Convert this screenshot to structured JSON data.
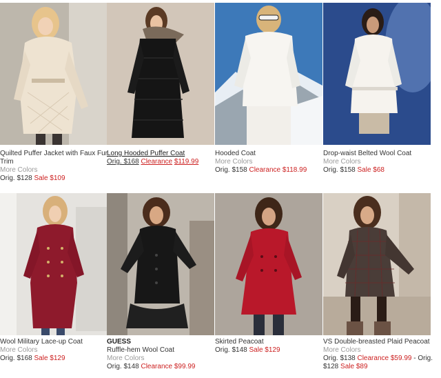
{
  "products": [
    {
      "name": "Quilted Puffer Jacket with Faux Fur Trim",
      "more_colors": "More Colors",
      "orig": "Orig.  $128",
      "sale_label": "Sale",
      "sale_price": "$109",
      "photo": "woman in cream quilted puffer jacket",
      "coat_color": "#efe4d2",
      "bg_color": "#c8c2b6"
    },
    {
      "name": "Long Hooded Puffer Coat",
      "orig": "Orig.  $168",
      "clearance_label": "Clearance",
      "clearance_price": "$119.99",
      "photo": "woman in long black hooded puffer coat",
      "coat_color": "#1a1a1a",
      "bg_color": "#cfc3b6"
    },
    {
      "name": "Hooded Coat",
      "more_colors": "More Colors",
      "orig": "Orig.  $158",
      "clearance_label": "Clearance",
      "clearance_price": "$118.99",
      "photo": "woman in white hooded coat on snowy mountain",
      "coat_color": "#f6f4f0",
      "bg_color": "#3c78b8"
    },
    {
      "name": "Drop-waist Belted Wool Coat",
      "more_colors": "More Colors",
      "orig": "Orig.  $158",
      "sale_label": "Sale",
      "sale_price": "$68",
      "photo": "woman in white drop-waist belted wool coat",
      "coat_color": "#f4f1ec",
      "bg_color": "#2a4a8a"
    },
    {
      "name": "Wool Military Lace-up Coat",
      "more_colors": "More Colors",
      "orig": "Orig.  $168",
      "sale_label": "Sale",
      "sale_price": "$129",
      "photo": "woman in red wool military coat",
      "coat_color": "#8e1a2c",
      "bg_color": "#e6e4e0"
    },
    {
      "brand": "GUESS",
      "name": "Ruffle-hem Wool Coat",
      "more_colors": "More Colors",
      "orig": "Orig.  $148",
      "clearance_label": "Clearance",
      "clearance_price": "$99.99",
      "photo": "woman in black ruffle-hem wool coat",
      "coat_color": "#181818",
      "bg_color": "#bfb7ad"
    },
    {
      "name": "Skirted Peacoat",
      "orig": "Orig.  $148",
      "sale_label": "Sale",
      "sale_price": "$129",
      "photo": "woman in red skirted peacoat",
      "coat_color": "#b8182a",
      "bg_color": "#a9a199"
    },
    {
      "name": "VS Double-breasted Plaid Peacoat",
      "more_colors": "More Colors",
      "orig": "Orig. $138",
      "clearance_label": "Clearance",
      "clearance_price": "$59.99",
      "extra": "- Orig.",
      "orig2": "$128",
      "sale_label": "Sale",
      "sale_price": "$89",
      "photo": "woman in dark plaid double-breasted peacoat",
      "coat_color": "#4a3d38",
      "bg_color": "#d8cfc4"
    }
  ]
}
